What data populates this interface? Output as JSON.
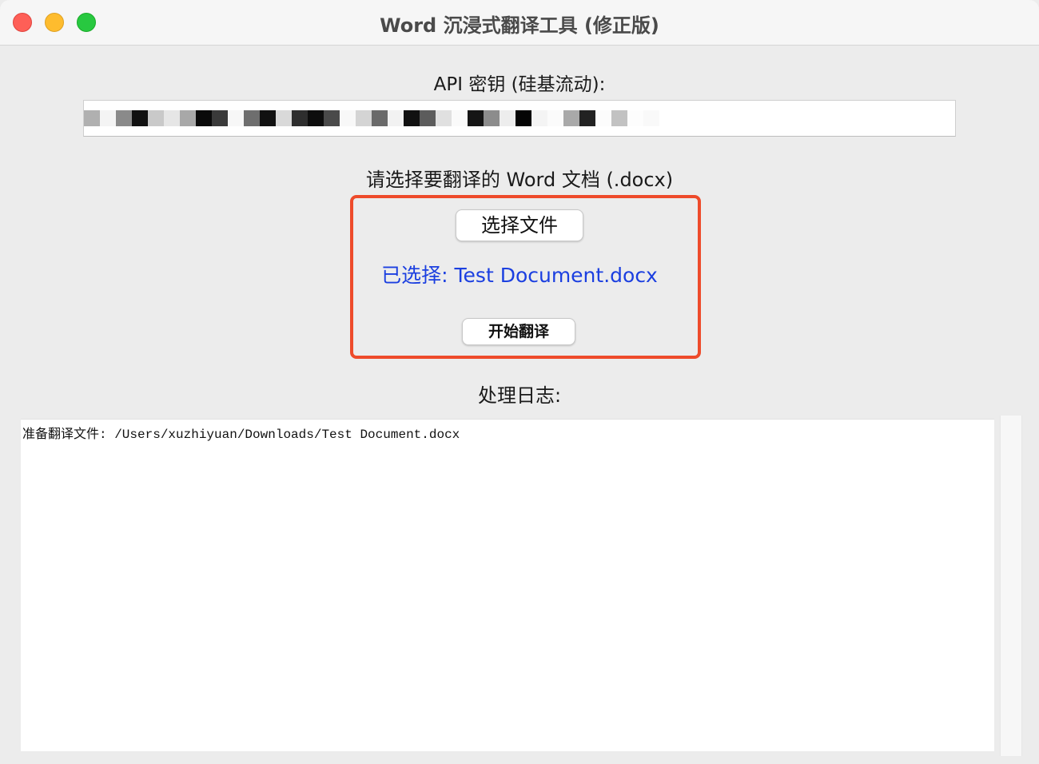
{
  "window": {
    "title": "Word 沉浸式翻译工具 (修正版)"
  },
  "api": {
    "label": "API 密钥 (硅基流动):",
    "value_redacted": true
  },
  "document": {
    "prompt": "请选择要翻译的 Word 文档 (.docx)",
    "choose_button": "选择文件",
    "selected_text": "已选择: Test Document.docx",
    "start_button": "开始翻译"
  },
  "log": {
    "label": "处理日志:",
    "lines": [
      "准备翻译文件: /Users/xuzhiyuan/Downloads/Test Document.docx"
    ]
  },
  "colors": {
    "highlight_border": "#ee4b2b",
    "selected_text": "#1b3fe0",
    "close": "#fe5f57",
    "minimize": "#febc2e",
    "maximize": "#28c840"
  }
}
